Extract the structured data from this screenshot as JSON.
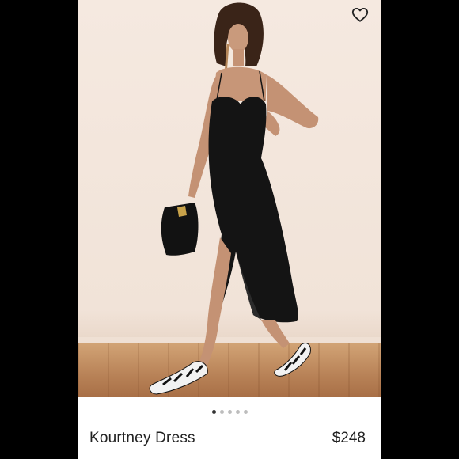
{
  "product": {
    "name": "Kourtney Dress",
    "price": "$248"
  },
  "carousel": {
    "total": 5,
    "active_index": 0
  },
  "icons": {
    "favorite": "heart-outline-icon"
  },
  "colors": {
    "background": "#000000",
    "card": "#ffffff",
    "text": "#222222",
    "dot_active": "#333333",
    "dot_inactive": "#bdbdbd"
  }
}
